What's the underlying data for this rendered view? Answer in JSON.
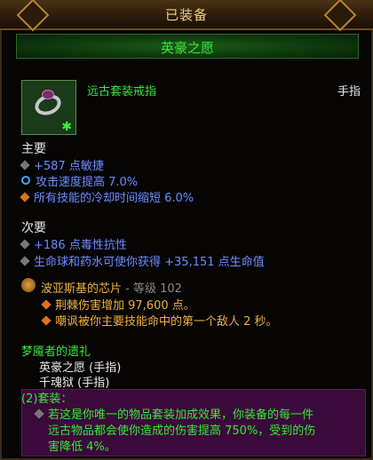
{
  "title": "已装备",
  "item_name": "英豪之愿",
  "item_type": "远古套装戒指",
  "slot": "手指",
  "primary_label": "主要",
  "primary_stats": [
    "+587 点敏捷",
    "攻击速度提高 7.0%",
    "所有技能的冷却时间缩短 6.0%"
  ],
  "secondary_label": "次要",
  "secondary_stats": [
    "+186 点毒性抗性",
    "生命球和药水可使你获得 +35,151 点生命值"
  ],
  "legendary_gem": {
    "name": "波亚斯基的芯片",
    "level_text": " - 等级 102",
    "effects": [
      "荆棘伤害增加 97,600 点。",
      "嘲讽被你主要技能命中的第一个敌人 2 秒。"
    ]
  },
  "set_name": "梦魇者的遗礼",
  "set_items": [
    "英豪之愿 (手指)",
    "千魂狱 (手指)"
  ],
  "set_bonus_label": "(2)套装：",
  "set_bonus_lines": [
    "若这是你唯一的物品套装加成效果，你装备的每一件",
    "远古物品都会使你造成的伤害提高 750%，受到的伤",
    "害降低 4%。"
  ],
  "icons": [
    "ring-icon",
    "set-star-icon",
    "gem-icon"
  ],
  "colors": {
    "set_green": "#38e838",
    "stat_blue": "#6f8cff",
    "title_gold": "#f0d27a",
    "set_bg": "#3a0a3a"
  }
}
